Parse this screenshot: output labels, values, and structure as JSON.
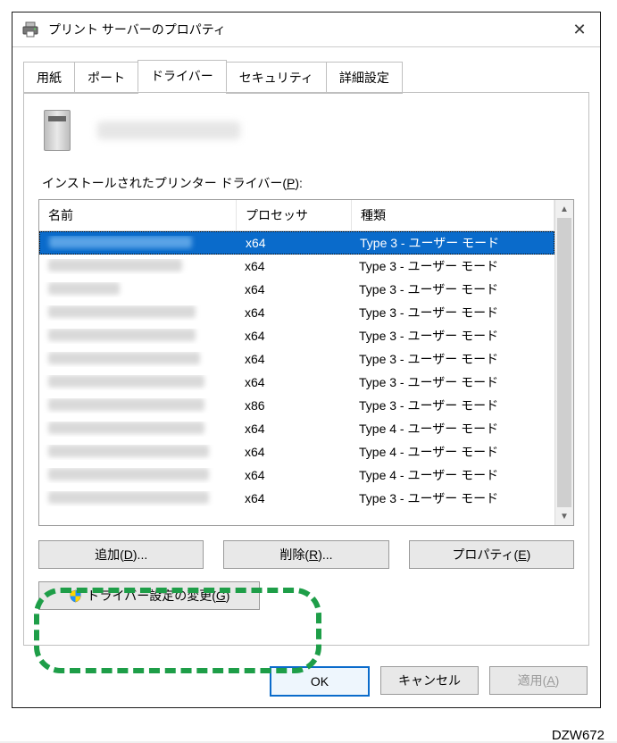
{
  "window": {
    "title": "プリント サーバーのプロパティ"
  },
  "tabs": {
    "paper": "用紙",
    "port": "ポート",
    "driver": "ドライバー",
    "security": "セキュリティ",
    "advanced": "詳細設定"
  },
  "listLabel": {
    "pre": "インストールされたプリンター ドライバー(",
    "accel": "P",
    "post": "):"
  },
  "columns": {
    "name": "名前",
    "processor": "プロセッサ",
    "type": "種類"
  },
  "rows": [
    {
      "proc": "x64",
      "type": "Type 3 - ユーザー モード",
      "selected": true,
      "blur": 160
    },
    {
      "proc": "x64",
      "type": "Type 3 - ユーザー モード",
      "blur": 150
    },
    {
      "proc": "x64",
      "type": "Type 3 - ユーザー モード",
      "blur": 80
    },
    {
      "proc": "x64",
      "type": "Type 3 - ユーザー モード",
      "blur": 165
    },
    {
      "proc": "x64",
      "type": "Type 3 - ユーザー モード",
      "blur": 165
    },
    {
      "proc": "x64",
      "type": "Type 3 - ユーザー モード",
      "blur": 170
    },
    {
      "proc": "x64",
      "type": "Type 3 - ユーザー モード",
      "blur": 175
    },
    {
      "proc": "x86",
      "type": "Type 3 - ユーザー モード",
      "blur": 175
    },
    {
      "proc": "x64",
      "type": "Type 4 - ユーザー モード",
      "blur": 175
    },
    {
      "proc": "x64",
      "type": "Type 4 - ユーザー モード",
      "blur": 180
    },
    {
      "proc": "x64",
      "type": "Type 4 - ユーザー モード",
      "blur": 180
    },
    {
      "proc": "x64",
      "type": "Type 3 - ユーザー モード",
      "blur": 180
    }
  ],
  "buttons": {
    "add": {
      "pre": "追加(",
      "accel": "D",
      "post": ")..."
    },
    "remove": {
      "pre": "削除(",
      "accel": "R",
      "post": ")..."
    },
    "prop": {
      "pre": "プロパティ(",
      "accel": "E",
      "post": ")"
    },
    "change": {
      "pre": "ドライバー設定の変更(",
      "accel": "G",
      "post": ")"
    },
    "ok": "OK",
    "cancel": "キャンセル",
    "apply": {
      "pre": "適用(",
      "accel": "A",
      "post": ")"
    }
  },
  "figcode": "DZW672"
}
